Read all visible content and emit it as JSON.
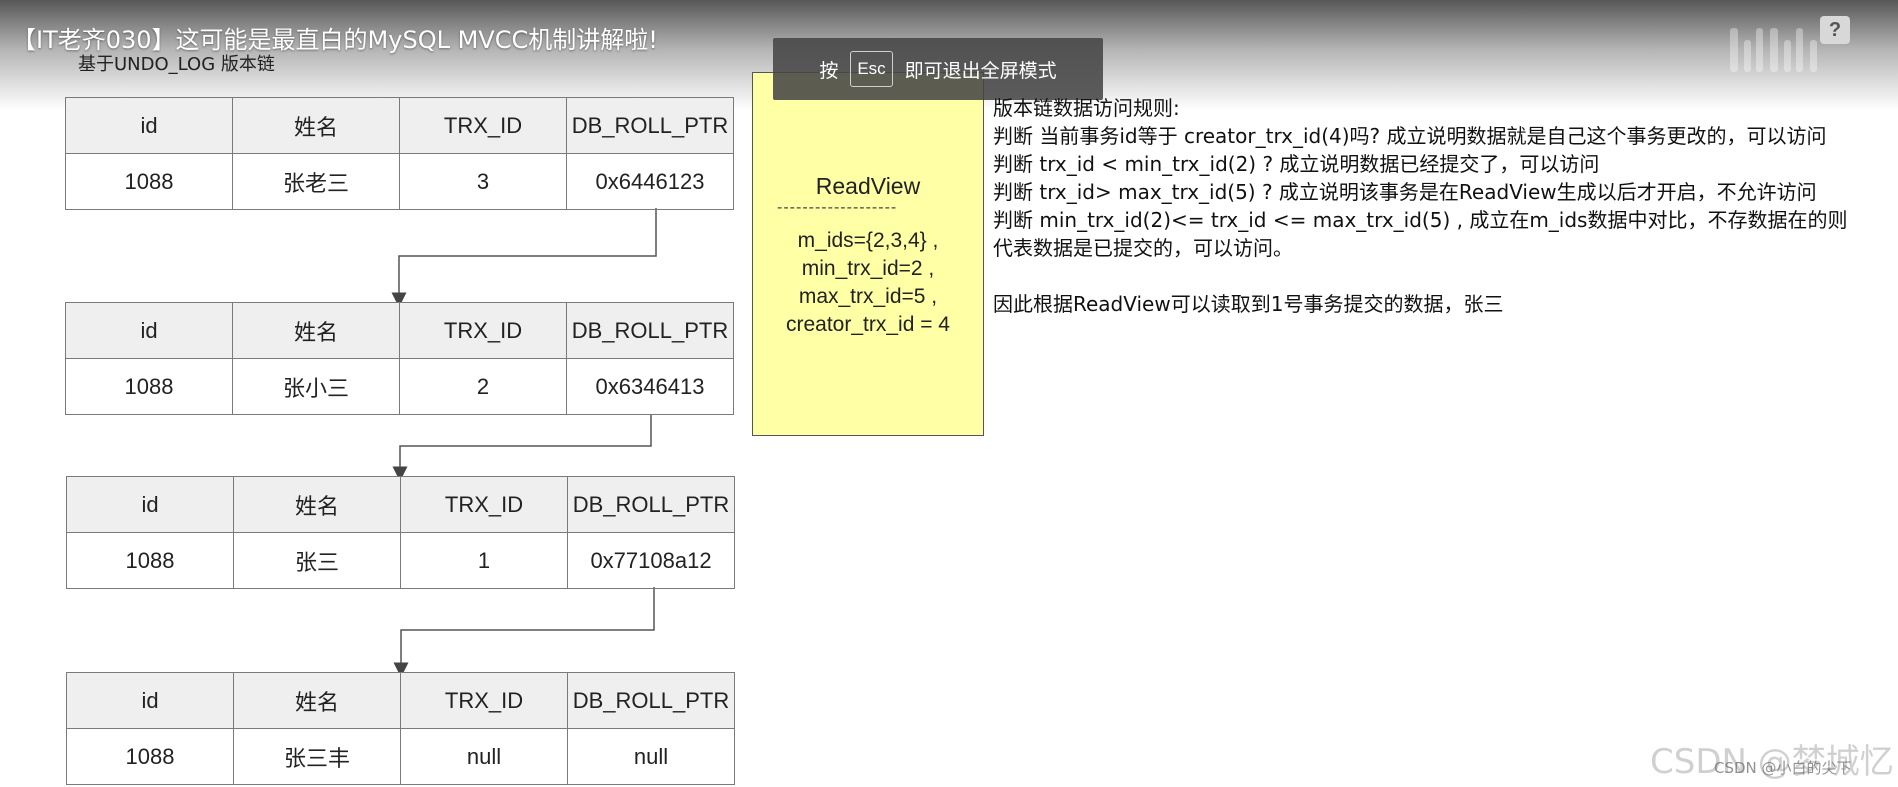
{
  "video": {
    "title": "【IT老齐030】这可能是最直白的MySQL MVCC机制讲解啦!",
    "subtitle": "基于UNDO_LOG 版本链",
    "help_label": "?"
  },
  "fullscreen_toast": {
    "prefix": "按",
    "key": "Esc",
    "suffix": "即可退出全屏模式"
  },
  "undo_tables": [
    {
      "headers": [
        "id",
        "姓名",
        "TRX_ID",
        "DB_ROLL_PTR"
      ],
      "row": [
        "1088",
        "张老三",
        "3",
        "0x6446123"
      ]
    },
    {
      "headers": [
        "id",
        "姓名",
        "TRX_ID",
        "DB_ROLL_PTR"
      ],
      "row": [
        "1088",
        "张小三",
        "2",
        "0x6346413"
      ]
    },
    {
      "headers": [
        "id",
        "姓名",
        "TRX_ID",
        "DB_ROLL_PTR"
      ],
      "row": [
        "1088",
        "张三",
        "1",
        "0x77108a12"
      ]
    },
    {
      "headers": [
        "id",
        "姓名",
        "TRX_ID",
        "DB_ROLL_PTR"
      ],
      "row": [
        "1088",
        "张三丰",
        "null",
        "null"
      ]
    }
  ],
  "readview": {
    "title": "ReadView",
    "divider": "-------------------",
    "m_ids": "m_ids={2,3,4} ,",
    "min_trx_id": "min_trx_id=2 ,",
    "max_trx_id": "max_trx_id=5 ,",
    "creator_trx_id": "creator_trx_id = 4"
  },
  "rules": {
    "heading": "版本链数据访问规则:",
    "rule1": "判断 当前事务id等于 creator_trx_id(4)吗? 成立说明数据就是自己这个事务更改的，可以访问",
    "rule2": "判断 trx_id < min_trx_id(2) ? 成立说明数据已经提交了，可以访问",
    "rule3": "判断 trx_id> max_trx_id(5) ? 成立说明该事务是在ReadView生成以后才开启，不允许访问",
    "rule4": "判断 min_trx_id(2)<= trx_id <= max_trx_id(5) , 成立在m_ids数据中对比，不存数据在的则代表数据是已提交的，可以访问。",
    "conclusion": "因此根据ReadView可以读取到1号事务提交的数据，张三"
  },
  "watermark": {
    "large": "CSDN @梦城忆",
    "small": "CSDN @小白的尖下"
  },
  "colors": {
    "readview_bg": "#ffffa6",
    "header_bg": "#efefef",
    "border": "#7a7a7a"
  }
}
